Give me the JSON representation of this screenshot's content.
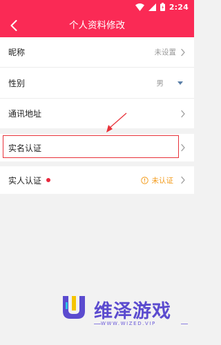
{
  "status_bar": {
    "time": "2:24",
    "icons": [
      "wifi-icon",
      "signal-icon",
      "battery-icon"
    ]
  },
  "header": {
    "title": "个人资料修改",
    "back_icon": "chevron-left-icon"
  },
  "profile_rows": {
    "nickname": {
      "label": "昵称",
      "value": "未设置"
    },
    "gender": {
      "label": "性别",
      "value": "男"
    },
    "address": {
      "label": "通讯地址"
    },
    "real_name": {
      "label": "实名认证"
    },
    "person_verify": {
      "label": "实人认证",
      "status": "未认证"
    }
  },
  "watermark": {
    "title": "维泽游戏",
    "url": "WWW.WIZED.VIP"
  },
  "colors": {
    "brand": "#fa2a55",
    "status_warning": "#f39a18",
    "highlight": "#e8323a",
    "watermark": "#5b4bcf"
  }
}
